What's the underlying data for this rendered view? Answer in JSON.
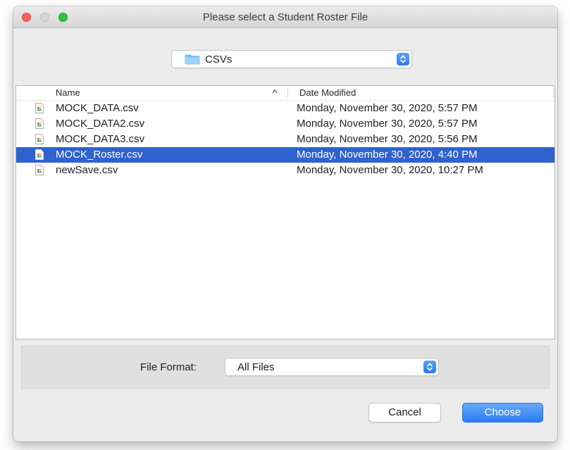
{
  "window": {
    "title": "Please select a Student Roster File"
  },
  "location": {
    "folder_icon": "folder-icon",
    "label": "CSVs"
  },
  "file_list": {
    "headers": {
      "name": "Name",
      "sort_indicator": "^",
      "date": "Date Modified"
    },
    "rows": [
      {
        "name": "MOCK_DATA.csv",
        "date": "Monday, November 30, 2020, 5:57 PM",
        "selected": false
      },
      {
        "name": "MOCK_DATA2.csv",
        "date": "Monday, November 30, 2020, 5:57 PM",
        "selected": false
      },
      {
        "name": "MOCK_DATA3.csv",
        "date": "Monday, November 30, 2020, 5:56 PM",
        "selected": false
      },
      {
        "name": "MOCK_Roster.csv",
        "date": "Monday, November 30, 2020, 4:40 PM",
        "selected": true
      },
      {
        "name": "newSave.csv",
        "date": "Monday, November 30, 2020, 10:27 PM",
        "selected": false
      }
    ]
  },
  "file_format": {
    "label": "File Format:",
    "value": "All Files"
  },
  "buttons": {
    "cancel": "Cancel",
    "choose": "Choose"
  },
  "colors": {
    "selection": "#2f62cf",
    "accent": "#2a7cf2",
    "close": "#fc5f57",
    "maximize": "#29c33f"
  }
}
